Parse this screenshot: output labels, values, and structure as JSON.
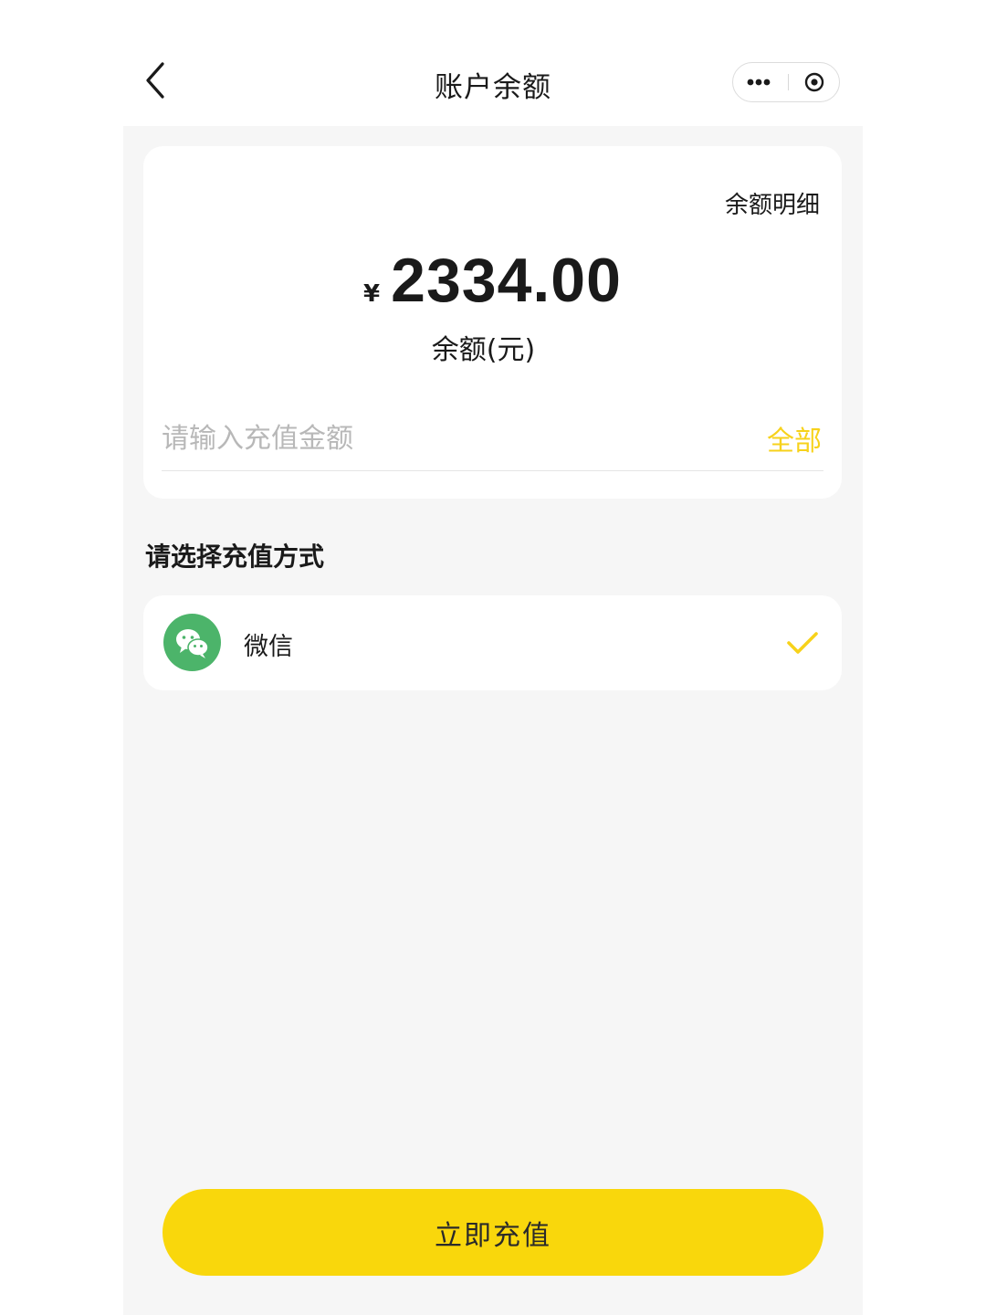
{
  "header": {
    "title": "账户余额",
    "back_icon": "chevron-left-icon",
    "more_icon": "more-dots-icon",
    "close_icon": "target-close-icon"
  },
  "balance_card": {
    "detail_link": "余额明细",
    "currency_symbol": "¥",
    "amount": "2334.00",
    "amount_label": "余额(元)",
    "input_placeholder": "请输入充值金额",
    "input_value": "",
    "all_button": "全部"
  },
  "payment": {
    "section_title": "请选择充值方式",
    "methods": [
      {
        "label": "微信",
        "icon": "wechat-icon",
        "selected": true
      }
    ]
  },
  "submit_button": "立即充值",
  "colors": {
    "accent": "#f9d70c",
    "accent_text": "#f7d21b",
    "wechat_green": "#4cb46a",
    "background": "#f6f6f6"
  }
}
